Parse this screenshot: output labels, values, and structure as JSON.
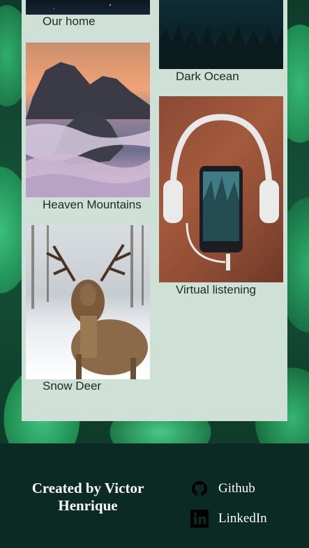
{
  "gallery": {
    "items": [
      {
        "caption": "Our home"
      },
      {
        "caption": "Dark Ocean"
      },
      {
        "caption": "Heaven Mountains"
      },
      {
        "caption": "Virtual listening"
      },
      {
        "caption": "Snow Deer"
      }
    ]
  },
  "footer": {
    "credit": "Created by Victor Henrique",
    "links": [
      {
        "label": "Github",
        "icon": "github-icon"
      },
      {
        "label": "LinkedIn",
        "icon": "linkedin-icon"
      }
    ]
  }
}
